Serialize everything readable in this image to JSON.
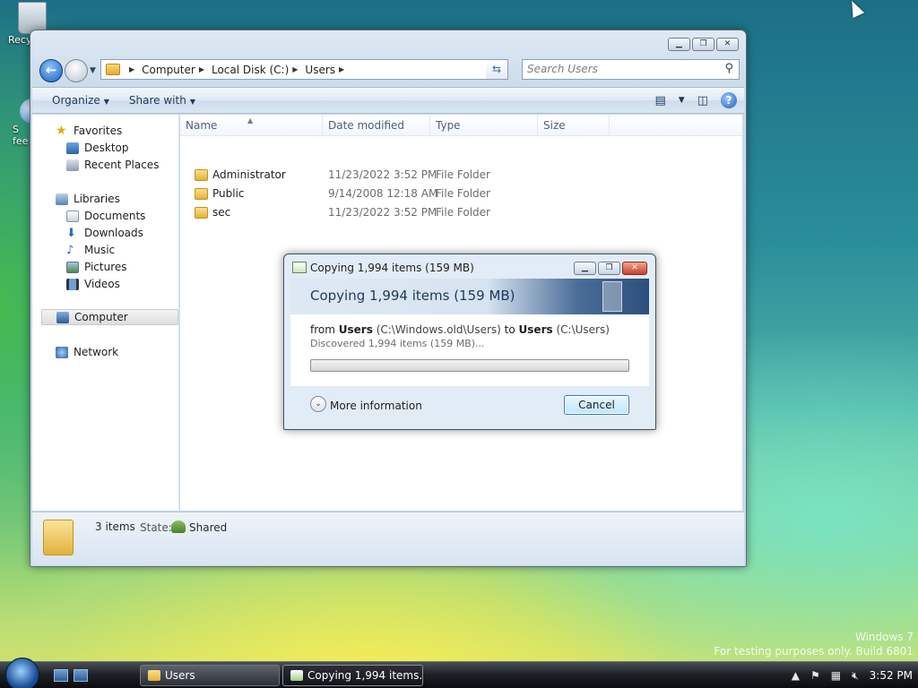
{
  "desktop": {
    "icons": [
      {
        "label": "Recy",
        "icon": "recycle-bin-icon"
      },
      {
        "label": "S\nfee",
        "icon": "feedback-icon"
      }
    ],
    "watermark_line1": "Windows 7",
    "watermark_line2": "For testing purposes only. Build 6801"
  },
  "explorer": {
    "window_controls": {
      "minimize": "▁",
      "maximize": "❐",
      "close": "✕"
    },
    "breadcrumb": [
      "Computer",
      "Local Disk (C:)",
      "Users"
    ],
    "search_placeholder": "Search Users",
    "toolbar": {
      "organize": "Organize",
      "share_with": "Share with"
    },
    "nav": {
      "favorites": "Favorites",
      "desktop": "Desktop",
      "recent_places": "Recent Places",
      "libraries": "Libraries",
      "documents": "Documents",
      "downloads": "Downloads",
      "music": "Music",
      "pictures": "Pictures",
      "videos": "Videos",
      "computer": "Computer",
      "network": "Network"
    },
    "columns": [
      "Name",
      "Date modified",
      "Type",
      "Size"
    ],
    "rows": [
      {
        "name": "Administrator",
        "date": "11/23/2022 3:52 PM",
        "type": "File Folder"
      },
      {
        "name": "Public",
        "date": "9/14/2008 12:18 AM",
        "type": "File Folder"
      },
      {
        "name": "sec",
        "date": "11/23/2022 3:52 PM",
        "type": "File Folder"
      }
    ],
    "status": {
      "count": "3 items",
      "state_label": "State:",
      "state_value": "Shared"
    }
  },
  "dialog": {
    "title": "Copying 1,994 items (159 MB)",
    "heading": "Copying 1,994 items (159 MB)",
    "from_word": "from",
    "from_name": "Users",
    "from_path": "(C:\\Windows.old\\Users)",
    "to_word": "to",
    "to_name": "Users",
    "to_path": "(C:\\Users)",
    "discovered": "Discovered 1,994 items (159 MB)...",
    "progress": 0,
    "more_info": "More information",
    "cancel": "Cancel"
  },
  "taskbar": {
    "buttons": [
      {
        "label": "Users",
        "active": false
      },
      {
        "label": "Copying 1,994 items...",
        "active": true
      }
    ],
    "clock": "3:52 PM"
  }
}
